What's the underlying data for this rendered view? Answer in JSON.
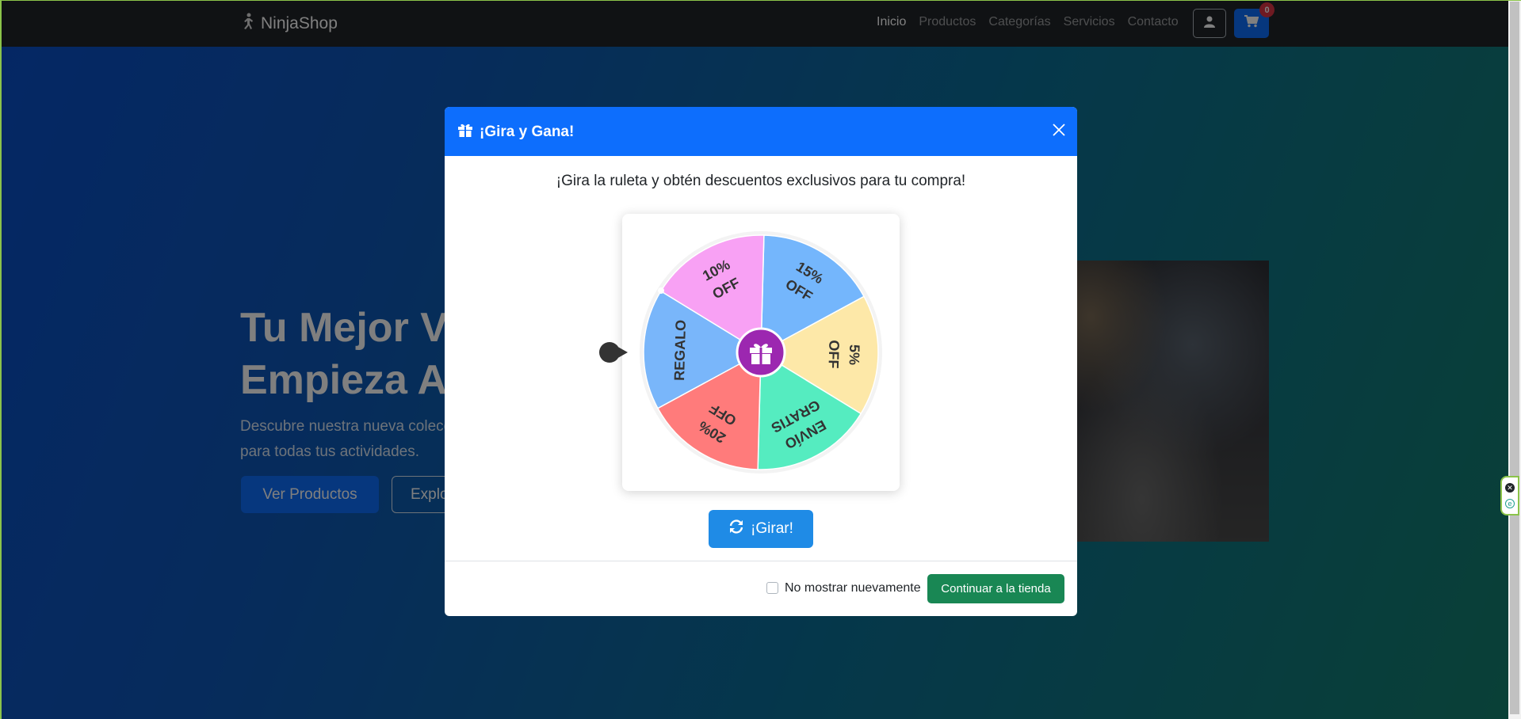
{
  "navbar": {
    "brand": "NinjaShop",
    "links": [
      "Inicio",
      "Productos",
      "Categorías",
      "Servicios",
      "Contacto"
    ],
    "active_link": "Inicio",
    "cart_count": "0"
  },
  "hero": {
    "title": "Tu Mejor V\nEmpieza A",
    "subtitle": "Descubre nuestra nueva colecc para todas tus actividades.",
    "primary_button": "Ver Productos",
    "secondary_button": "Explo"
  },
  "modal": {
    "title": "¡Gira y Gana!",
    "intro": "¡Gira la ruleta y obtén descuentos exclusivos para tu compra!",
    "wheel_segments": [
      {
        "line1": "15%",
        "line2": "OFF",
        "color": "#74b6fc"
      },
      {
        "line1": "5%",
        "line2": "OFF",
        "color": "#fde8a8"
      },
      {
        "line1": "ENVÍO",
        "line2": "GRATIS",
        "color": "#55ecc0"
      },
      {
        "line1": "20%",
        "line2": "OFF",
        "color": "#ff7b7b"
      },
      {
        "line1": "REGALO",
        "line2": "",
        "color": "#79b6fa"
      },
      {
        "line1": "10%",
        "line2": "OFF",
        "color": "#f8a1f4"
      }
    ],
    "center_color": "#9c27b0",
    "spin_button": "¡Girar!",
    "dont_show_label": "No mostrar nuevamente",
    "continue_button": "Continuar a la tienda"
  },
  "colors": {
    "primary": "#0d6efd",
    "success": "#198754",
    "navbar": "#212529"
  },
  "icons": [
    "running-icon",
    "user-icon",
    "cart-icon",
    "gift-icon",
    "close-icon",
    "refresh-icon"
  ]
}
